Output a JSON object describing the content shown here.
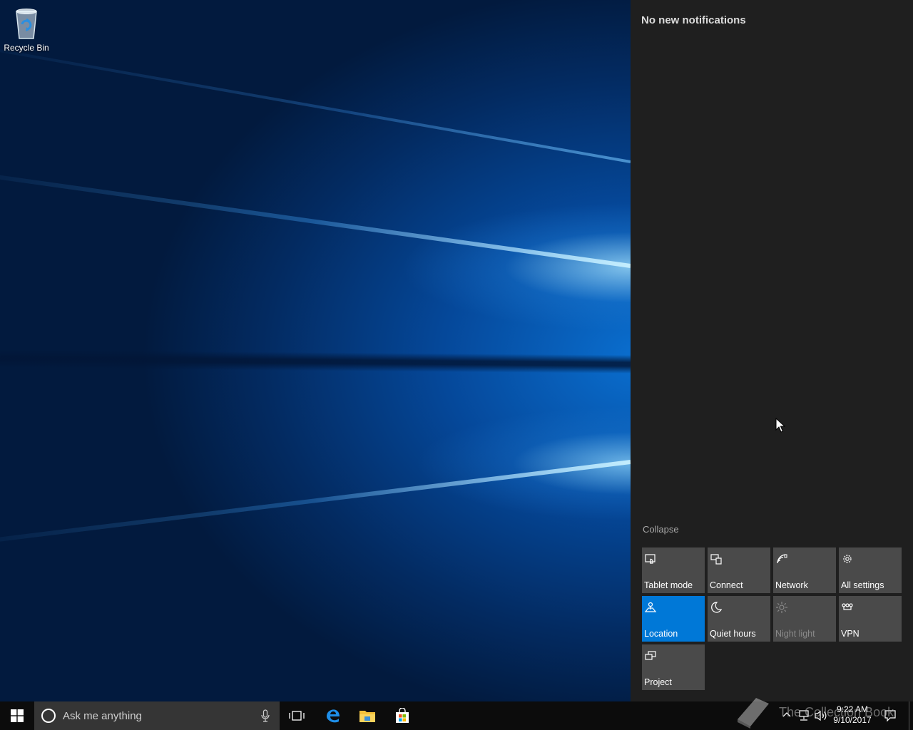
{
  "desktop": {
    "icons": [
      {
        "label": "Recycle Bin",
        "icon": "recycle-bin-icon"
      }
    ]
  },
  "action_center": {
    "title": "No new notifications",
    "collapse_label": "Collapse",
    "tiles": [
      {
        "label": "Tablet mode",
        "icon": "tablet-mode-icon",
        "state": "off"
      },
      {
        "label": "Connect",
        "icon": "connect-icon",
        "state": "off"
      },
      {
        "label": "Network",
        "icon": "network-icon",
        "state": "off"
      },
      {
        "label": "All settings",
        "icon": "gear-icon",
        "state": "off"
      },
      {
        "label": "Location",
        "icon": "location-icon",
        "state": "on"
      },
      {
        "label": "Quiet hours",
        "icon": "moon-icon",
        "state": "off"
      },
      {
        "label": "Night light",
        "icon": "sun-icon",
        "state": "disabled"
      },
      {
        "label": "VPN",
        "icon": "vpn-icon",
        "state": "off"
      },
      {
        "label": "Project",
        "icon": "project-icon",
        "state": "off"
      }
    ]
  },
  "taskbar": {
    "search_placeholder": "Ask me anything",
    "apps": [
      "task-view-icon",
      "edge-icon",
      "file-explorer-icon",
      "store-icon"
    ],
    "clock": {
      "time": "9:22 AM",
      "date": "9/10/2017"
    },
    "watermark": "The Collection Book"
  },
  "colors": {
    "accent": "#0078d7",
    "tile": "#4a4a4a",
    "panel": "#1f1f1f",
    "taskbar": "#0c0c0c"
  }
}
